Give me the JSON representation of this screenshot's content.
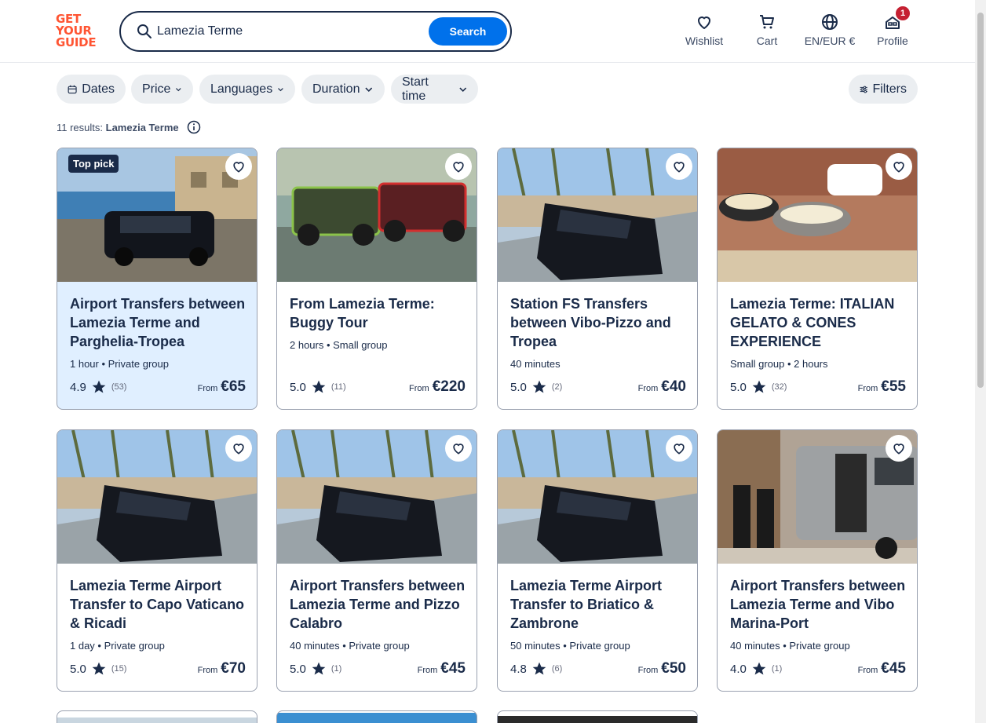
{
  "header": {
    "logo_lines": [
      "GET",
      "YOUR",
      "GUIDE"
    ],
    "search_value": "Lamezia Terme",
    "search_button": "Search",
    "nav": [
      {
        "label": "Wishlist",
        "icon": "heart-icon"
      },
      {
        "label": "Cart",
        "icon": "cart-icon"
      },
      {
        "label": "EN/EUR €",
        "icon": "globe-icon"
      },
      {
        "label": "Profile",
        "icon": "profile-icon",
        "badge": "1"
      }
    ]
  },
  "filters": [
    {
      "label": "Dates",
      "icon": "calendar-icon"
    },
    {
      "label": "Price",
      "icon": "chevron-down-icon"
    },
    {
      "label": "Languages",
      "icon": "chevron-down-icon"
    },
    {
      "label": "Duration",
      "icon": "chevron-down-icon"
    },
    {
      "label": "Start time",
      "icon": "chevron-down-icon"
    }
  ],
  "filters_button": "Filters",
  "results": {
    "count_text": "11 results:",
    "query": "Lamezia Terme"
  },
  "from_label": "From",
  "top_pick_label": "Top pick",
  "cards": [
    {
      "title": "Airport Transfers between Lamezia Terme and Parghelia-Tropea",
      "meta": "1 hour • Private group",
      "rating": "4.9",
      "reviews": "(53)",
      "price": "€65",
      "top_pick": true
    },
    {
      "title": "From Lamezia Terme: Buggy Tour",
      "meta": "2 hours • Small group",
      "rating": "5.0",
      "reviews": "(11)",
      "price": "€220"
    },
    {
      "title": "Station FS Transfers between Vibo-Pizzo and Tropea",
      "meta": "40 minutes",
      "rating": "5.0",
      "reviews": "(2)",
      "price": "€40"
    },
    {
      "title": "Lamezia Terme: ITALIAN GELATO & CONES EXPERIENCE",
      "meta": "Small group • 2 hours",
      "rating": "5.0",
      "reviews": "(32)",
      "price": "€55"
    },
    {
      "title": "Lamezia Terme Airport Transfer to Capo Vaticano & Ricadi",
      "meta": "1 day • Private group",
      "rating": "5.0",
      "reviews": "(15)",
      "price": "€70"
    },
    {
      "title": "Airport Transfers between Lamezia Terme and Pizzo Calabro",
      "meta": "40 minutes • Private group",
      "rating": "5.0",
      "reviews": "(1)",
      "price": "€45"
    },
    {
      "title": "Lamezia Terme Airport Transfer to Briatico & Zambrone",
      "meta": "50 minutes • Private group",
      "rating": "4.8",
      "reviews": "(6)",
      "price": "€50"
    },
    {
      "title": "Airport Transfers between Lamezia Terme and Vibo Marina-Port",
      "meta": "40 minutes • Private group",
      "rating": "4.0",
      "reviews": "(1)",
      "price": "€45"
    }
  ],
  "colors": {
    "brand": "#ff5533",
    "primary": "#0071eb",
    "text": "#1a2b49",
    "highlight": "#e0efff",
    "badge": "#c52032"
  }
}
